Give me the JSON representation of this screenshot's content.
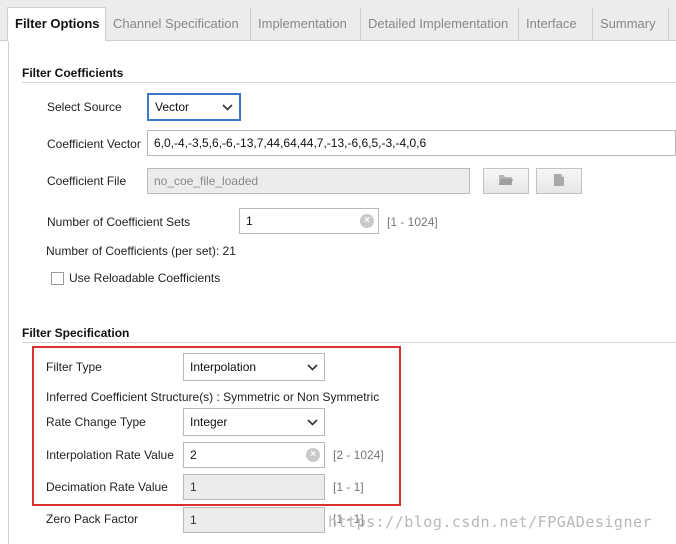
{
  "tabs": [
    {
      "label": "Filter Options"
    },
    {
      "label": "Channel Specification"
    },
    {
      "label": "Implementation"
    },
    {
      "label": "Detailed Implementation"
    },
    {
      "label": "Interface"
    },
    {
      "label": "Summary"
    }
  ],
  "filter_coefficients": {
    "title": "Filter Coefficients",
    "select_source_label": "Select Source",
    "select_source_value": "Vector",
    "coefficient_vector_label": "Coefficient Vector",
    "coefficient_vector_value": "6,0,-4,-3,5,6,-6,-13,7,44,64,44,7,-13,-6,6,5,-3,-4,0,6",
    "coefficient_file_label": "Coefficient File",
    "coefficient_file_value": "no_coe_file_loaded",
    "num_sets_label": "Number of Coefficient Sets",
    "num_sets_value": "1",
    "num_sets_range": "[1 - 1024]",
    "num_coeffs_text": "Number of Coefficients (per set): 21",
    "reloadable_label": "Use Reloadable Coefficients",
    "reloadable_checked": false
  },
  "filter_specification": {
    "title": "Filter Specification",
    "filter_type_label": "Filter Type",
    "filter_type_value": "Interpolation",
    "inferred_structure_text": "Inferred Coefficient Structure(s) : Symmetric or Non Symmetric",
    "rate_change_label": "Rate Change Type",
    "rate_change_value": "Integer",
    "interp_rate_label": "Interpolation Rate Value",
    "interp_rate_value": "2",
    "interp_rate_range": "[2 - 1024]",
    "decim_rate_label": "Decimation Rate Value",
    "decim_rate_value": "1",
    "decim_rate_range": "[1 - 1]",
    "zero_pack_label": "Zero Pack Factor",
    "zero_pack_value": "1",
    "zero_pack_range": "[1 - 1]"
  },
  "highlight_color": "#d9322e",
  "focus_color": "#3b78c8",
  "watermark": "https://blog.csdn.net/FPGADesigner"
}
